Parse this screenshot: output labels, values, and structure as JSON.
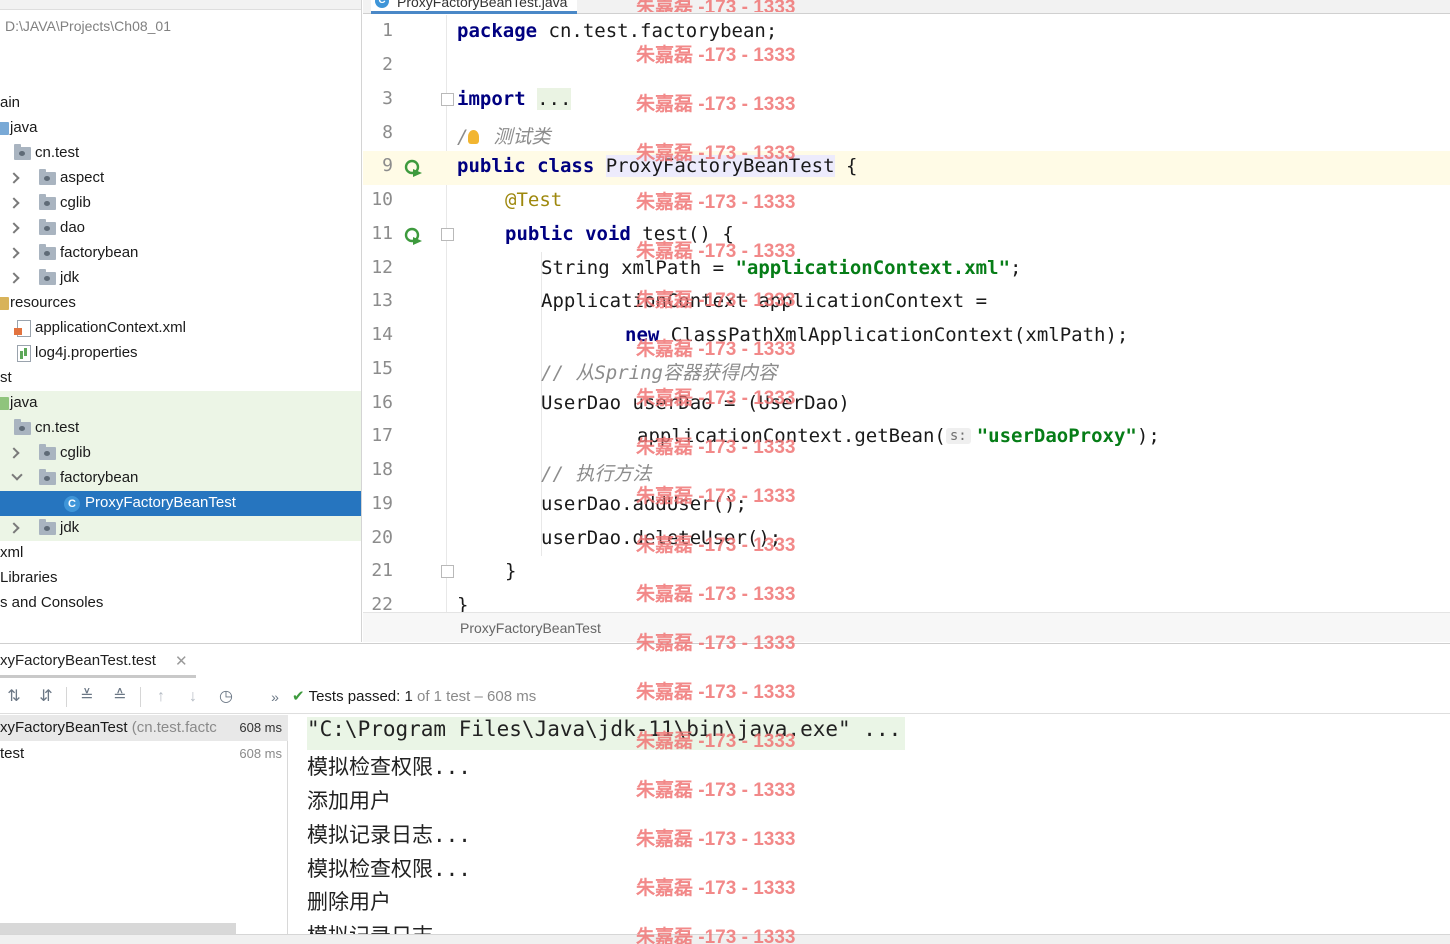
{
  "project": {
    "path": "D:\\JAVA\\Projects\\Ch08_01",
    "items": [
      {
        "label": "ain"
      },
      {
        "label": "java"
      },
      {
        "label": "cn.test"
      },
      {
        "label": "aspect"
      },
      {
        "label": "cglib"
      },
      {
        "label": "dao"
      },
      {
        "label": "factorybean"
      },
      {
        "label": "jdk"
      },
      {
        "label": "resources"
      },
      {
        "label": "applicationContext.xml"
      },
      {
        "label": "log4j.properties"
      },
      {
        "label": "st"
      },
      {
        "label": "java"
      },
      {
        "label": "cn.test"
      },
      {
        "label": "cglib"
      },
      {
        "label": "factorybean"
      },
      {
        "label": "ProxyFactoryBeanTest"
      },
      {
        "label": "jdk"
      },
      {
        "label": "xml"
      },
      {
        "label": "Libraries"
      },
      {
        "label": "s and Consoles"
      }
    ]
  },
  "editor": {
    "tab_label": "ProxyFactoryBeanTest.java",
    "breadcrumb": "ProxyFactoryBeanTest",
    "line_numbers": [
      "1",
      "2",
      "3",
      "8",
      "9",
      "10",
      "11",
      "12",
      "13",
      "14",
      "15",
      "16",
      "17",
      "18",
      "19",
      "20",
      "21",
      "22"
    ],
    "code": {
      "l1_kw": "package",
      "l1_rest": " cn.test.factorybean;",
      "l3_kw": "import",
      "l3_rest": "...",
      "l8_comment": "测试类",
      "l9_kw": "public class",
      "l9_name": "ProxyFactoryBeanTest",
      "l9_rest": " {",
      "l10_ann": "@Test",
      "l11_kw": "public void",
      "l11_rest": " test() {",
      "l12_pre": "String xmlPath = ",
      "l12_str": "\"applicationContext.xml\"",
      "l12_post": ";",
      "l13": "ApplicationContext applicationContext =",
      "l14_kw": "new",
      "l14_rest": " ClassPathXmlApplicationContext(xmlPath);",
      "l15_comment": "// 从Spring容器获得内容",
      "l16": "UserDao userDao = (UserDao)",
      "l17_pre": "applicationContext.getBean(",
      "l17_hint": "s:",
      "l17_str": "\"userDaoProxy\"",
      "l17_post": ");",
      "l18_comment": "// 执行方法",
      "l19": "userDao.addUser();",
      "l20": "userDao.deleteUser();",
      "l21": "}",
      "l22": "}"
    }
  },
  "run": {
    "tab_label": "xyFactoryBeanTest.test",
    "status_label": "Tests passed:",
    "status_count": "1",
    "status_rest": "of 1 test – 608 ms",
    "tree": [
      {
        "name": "xyFactoryBeanTest",
        "pkg": "(cn.test.factc",
        "time": "608 ms"
      },
      {
        "name": "test",
        "pkg": "",
        "time": "608 ms"
      }
    ],
    "console": [
      "\"C:\\Program Files\\Java\\jdk-11\\bin\\java.exe\" ...",
      "模拟检查权限...",
      "添加用户",
      "模拟记录日志...",
      "模拟检查权限...",
      "删除用户",
      "模拟记录日志..."
    ]
  },
  "watermark": "朱嘉磊 -173 - 1333",
  "colors": {
    "keyword": "#000080",
    "string": "#067d17",
    "comment": "#8c8c8c",
    "annotation": "#9e880d",
    "selection": "#2675bf",
    "watermark": "#f07575",
    "passed": "#3d9a3d"
  }
}
